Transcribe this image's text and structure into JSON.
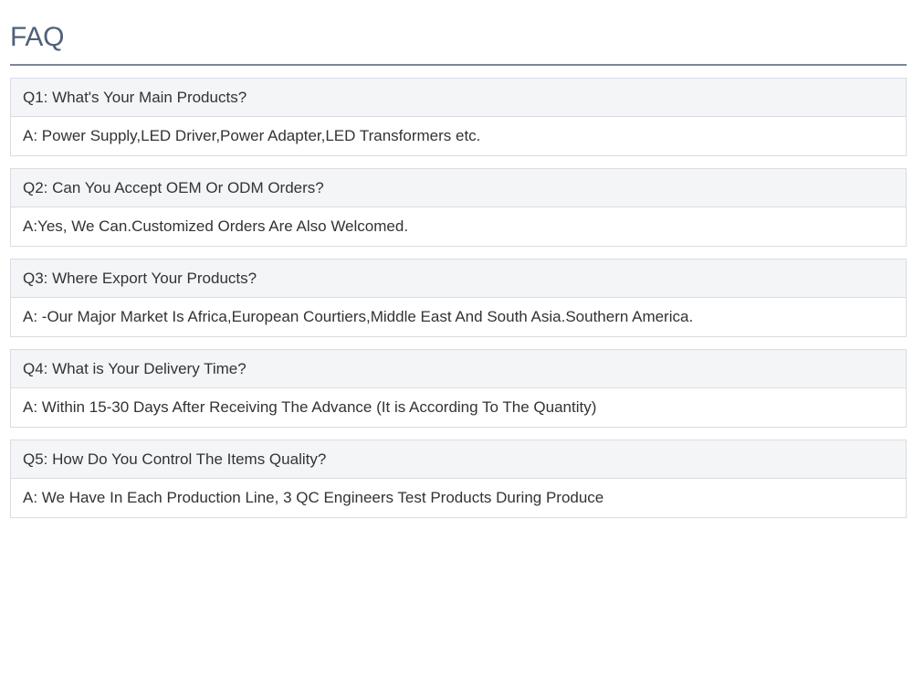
{
  "page": {
    "title": "FAQ"
  },
  "faq": [
    {
      "question": "Q1: What's Your Main Products?",
      "answer": "A: Power Supply,LED Driver,Power Adapter,LED Transformers etc."
    },
    {
      "question": "Q2: Can You Accept OEM Or ODM Orders?",
      "answer": "A:Yes, We Can.Customized Orders Are Also Welcomed."
    },
    {
      "question": "Q3: Where Export Your Products?",
      "answer": "A: -Our Major Market Is Africa,European Courtiers,Middle East And South Asia.Southern America."
    },
    {
      "question": "Q4: What is Your Delivery Time?",
      "answer": "A: Within 15-30 Days After Receiving The Advance (It is According To The Quantity)"
    },
    {
      "question": "Q5: How Do You Control The Items Quality?",
      "answer": "A: We Have In Each Production Line, 3 QC Engineers Test Products During Produce"
    }
  ],
  "colors": {
    "title": "#4f6079",
    "rule": "#7a8596",
    "question_bg": "#f4f5f7",
    "border": "#d9dce1",
    "text": "#333333"
  }
}
